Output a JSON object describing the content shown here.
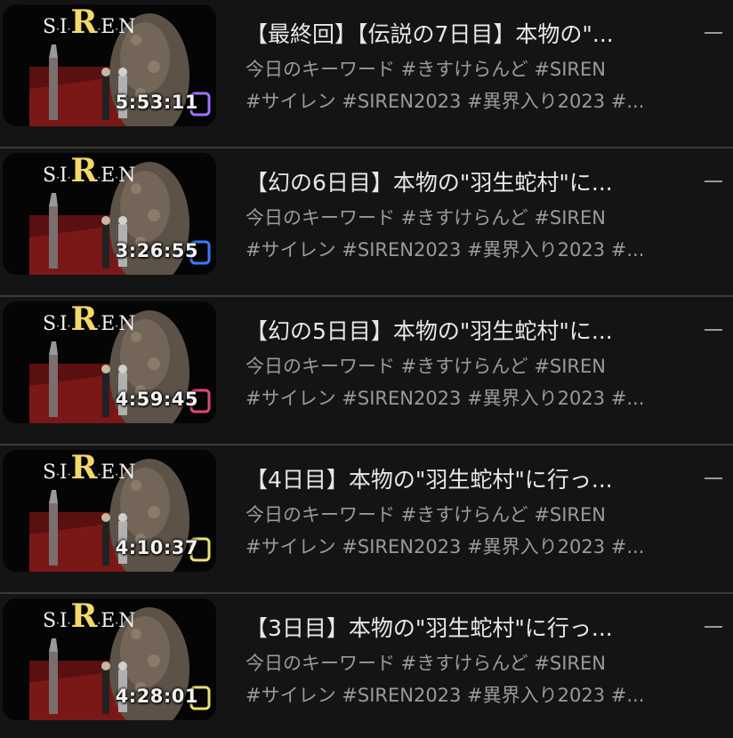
{
  "videos": [
    {
      "title": "【最終回】【伝説の7日目】本物の\"...",
      "desc_line1": "今日のキーワード #きすけらんど #SIREN",
      "desc_line2": "#サイレン #SIREN2023 #異界入り2023 #...",
      "duration": "5:53:11",
      "thumb_logo": "SIREN",
      "accent": "#a070ff"
    },
    {
      "title": "【幻の6日目】本物の\"羽生蛇村\"に...",
      "desc_line1": "今日のキーワード #きすけらんど #SIREN",
      "desc_line2": "#サイレン #SIREN2023 #異界入り2023 #...",
      "duration": "3:26:55",
      "thumb_logo": "SIREN",
      "accent": "#3a7bff"
    },
    {
      "title": "【幻の5日目】本物の\"羽生蛇村\"に...",
      "desc_line1": "今日のキーワード #きすけらんど #SIREN",
      "desc_line2": "#サイレン #SIREN2023 #異界入り2023 #...",
      "duration": "4:59:45",
      "thumb_logo": "SIREN",
      "accent": "#e0467a"
    },
    {
      "title": "【4日目】本物の\"羽生蛇村\"に行っ...",
      "desc_line1": "今日のキーワード #きすけらんど #SIREN",
      "desc_line2": "#サイレン #SIREN2023 #異界入り2023 #...",
      "duration": "4:10:37",
      "thumb_logo": "SIREN",
      "accent": "#f0e070"
    },
    {
      "title": "【3日目】本物の\"羽生蛇村\"に行っ...",
      "desc_line1": "今日のキーワード #きすけらんど #SIREN",
      "desc_line2": "#サイレン #SIREN2023 #異界入り2023 #...",
      "duration": "4:28:01",
      "thumb_logo": "SIREN",
      "accent": "#f0e070"
    }
  ]
}
